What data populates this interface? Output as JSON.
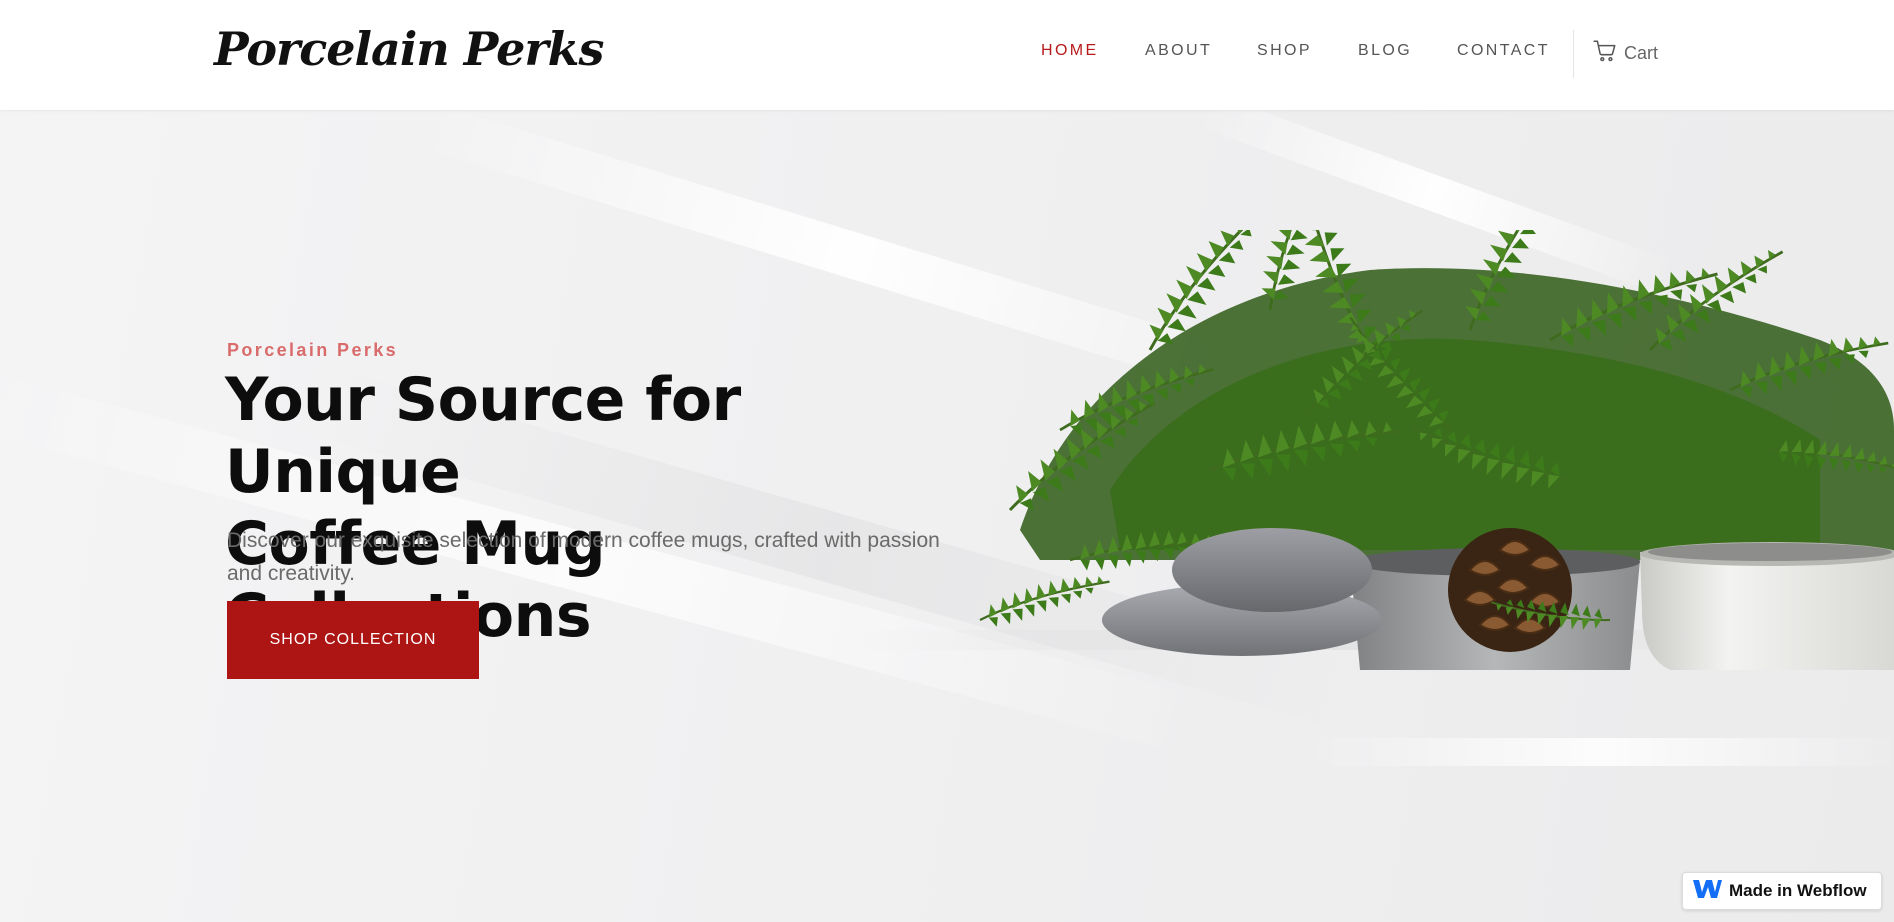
{
  "header": {
    "logo": "Porcelain Perks",
    "nav": [
      {
        "label": "HOME",
        "active": true
      },
      {
        "label": "ABOUT",
        "active": false
      },
      {
        "label": "SHOP",
        "active": false
      },
      {
        "label": "BLOG",
        "active": false
      },
      {
        "label": "CONTACT",
        "active": false
      }
    ],
    "cart_label": "Cart",
    "cart_icon": "cart-icon"
  },
  "hero": {
    "eyebrow": "Porcelain Perks",
    "headline_line1": "Your Source for Unique",
    "headline_line2": "Coffee Mug Collections",
    "subtitle": "Discover our exquisite selection of modern coffee mugs, crafted with passion and creativity.",
    "cta_label": "SHOP COLLECTION",
    "image_content": "fern-stones-pinecone-mug-illustration"
  },
  "badge": {
    "label": "Made in Webflow",
    "icon": "webflow-logo-icon"
  },
  "colors": {
    "accent": "#b81b1b",
    "button": "#ad1515",
    "eyebrow": "#d96b6b",
    "text_dark": "#0d0d0d",
    "text_muted": "#6a6a6a"
  }
}
